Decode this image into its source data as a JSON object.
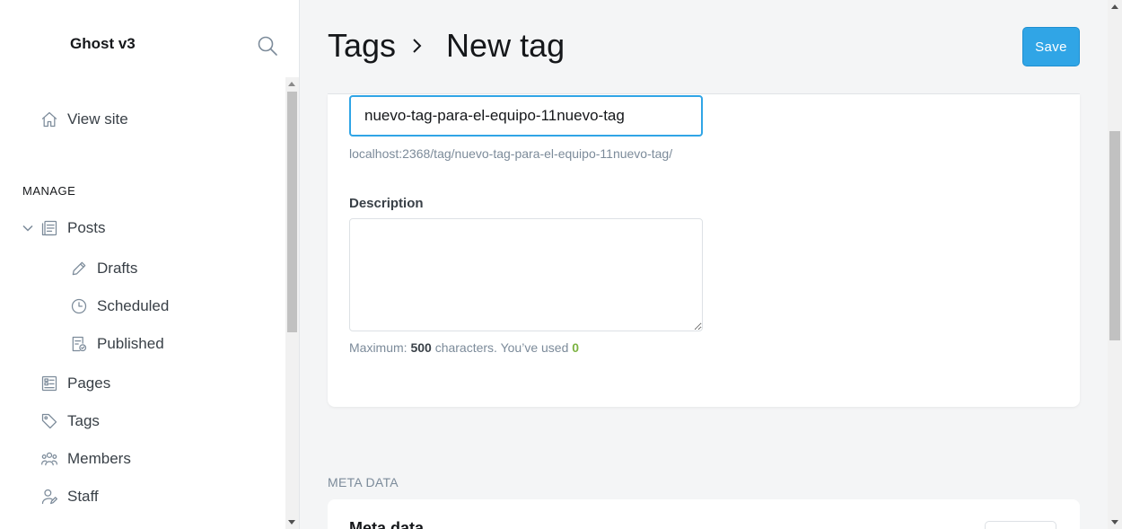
{
  "sidebar": {
    "brand": "Ghost v3",
    "view_site": "View site",
    "section_manage": "MANAGE",
    "items": {
      "posts": "Posts",
      "drafts": "Drafts",
      "scheduled": "Scheduled",
      "published": "Published",
      "pages": "Pages",
      "tags": "Tags",
      "members": "Members",
      "staff": "Staff"
    }
  },
  "header": {
    "breadcrumb_parent": "Tags",
    "breadcrumb_current": "New tag",
    "save_label": "Save"
  },
  "form": {
    "slug_value": "nuevo-tag-para-el-equipo-11nuevo-tag",
    "slug_url": "localhost:2368/tag/nuevo-tag-para-el-equipo-11nuevo-tag/",
    "description_label": "Description",
    "description_value": "",
    "hint_prefix": "Maximum: ",
    "hint_max": "500",
    "hint_middle": " characters. You’ve used ",
    "hint_used": "0"
  },
  "meta": {
    "section_label": "META DATA",
    "title": "Meta data"
  },
  "colors": {
    "accent": "#30a5e6",
    "used_count": "#7cb342"
  }
}
